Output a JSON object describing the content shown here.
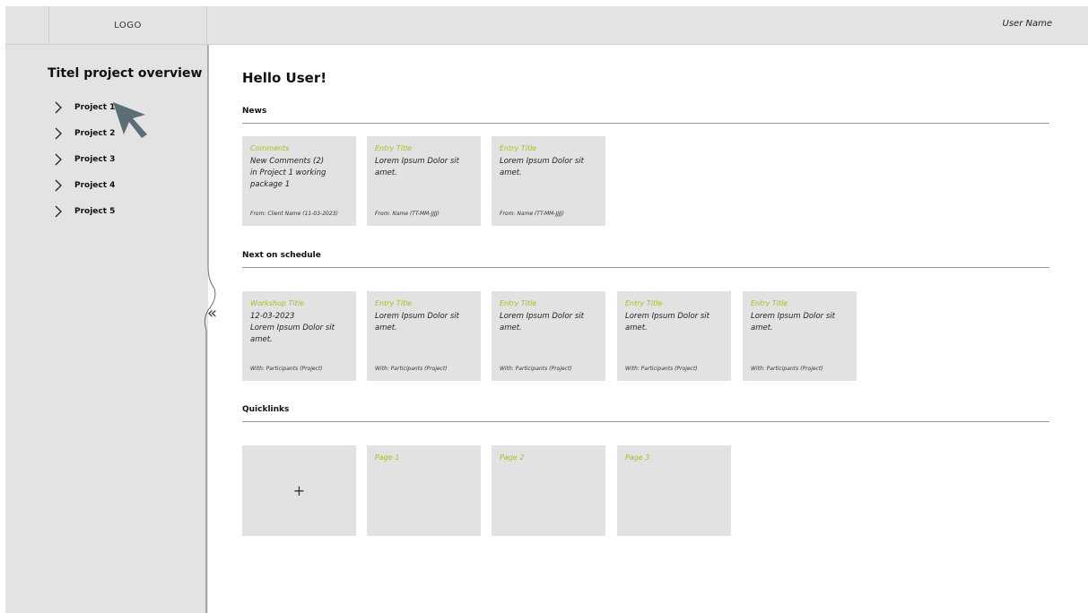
{
  "header": {
    "logo": "LOGO",
    "user_name": "User Name"
  },
  "sidebar": {
    "title": "Titel project overview",
    "items": [
      {
        "label": "Project 1"
      },
      {
        "label": "Project 2"
      },
      {
        "label": "Project 3"
      },
      {
        "label": "Project 4"
      },
      {
        "label": "Project 5"
      }
    ],
    "collapse_symbol": "«"
  },
  "main": {
    "greeting": "Hello User!",
    "news": {
      "title": "News",
      "cards": [
        {
          "title": "Comments",
          "body1": "New Comments (2)",
          "body2": "in Project 1 working package 1",
          "footer": "From: Client Name (11-03-2023)"
        },
        {
          "title": "Entry Title",
          "body1": "Lorem Ipsum Dolor sit amet.",
          "body2": "",
          "footer": "From: Name (TT-MM-JJJJ)"
        },
        {
          "title": "Entry Title",
          "body1": "Lorem Ipsum Dolor sit amet.",
          "body2": "",
          "footer": "From: Name (TT-MM-JJJJ)"
        }
      ]
    },
    "schedule": {
      "title": "Next on schedule",
      "cards": [
        {
          "title": "Workshop Title",
          "body1": "12-03-2023",
          "body2": "Lorem Ipsum Dolor sit amet.",
          "footer": "With: Participants (Project)"
        },
        {
          "title": "Entry Title",
          "body1": "Lorem Ipsum Dolor sit amet.",
          "body2": "",
          "footer": "With: Participants (Project)"
        },
        {
          "title": "Entry Title",
          "body1": "Lorem Ipsum Dolor sit amet.",
          "body2": "",
          "footer": "With: Participants (Project)"
        },
        {
          "title": "Entry Title",
          "body1": "Lorem Ipsum Dolor sit amet.",
          "body2": "",
          "footer": "With: Participants (Project)"
        },
        {
          "title": "Entry Title",
          "body1": "Lorem Ipsum Dolor sit amet.",
          "body2": "",
          "footer": "With: Participants (Project)"
        }
      ]
    },
    "quicklinks": {
      "title": "Quicklinks",
      "add_symbol": "+",
      "pages": [
        {
          "title": "Page 1"
        },
        {
          "title": "Page 2"
        },
        {
          "title": "Page 3"
        }
      ]
    }
  },
  "colors": {
    "accent": "#a4c21a",
    "panel": "#e3e3e3",
    "card": "#e2e2e2",
    "cursor": "#5b6e76"
  }
}
